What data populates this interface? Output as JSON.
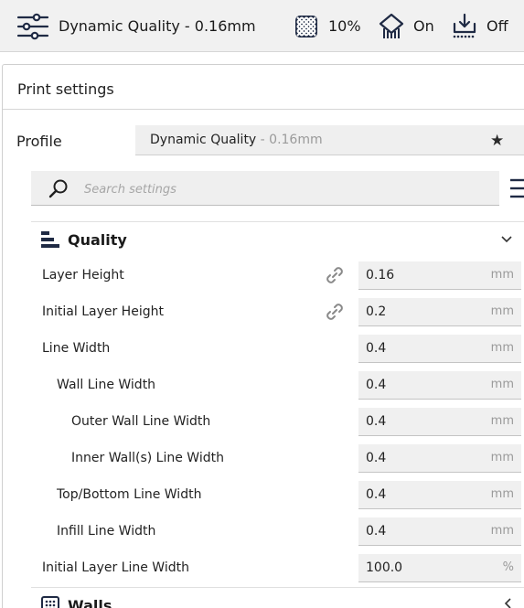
{
  "header": {
    "profile_summary": "Dynamic Quality - 0.16mm",
    "infill_value": "10%",
    "support_value": "On",
    "adhesion_value": "Off",
    "icons": [
      "sliders-icon",
      "infill-icon",
      "support-icon",
      "adhesion-icon"
    ]
  },
  "panel": {
    "title": "Print settings"
  },
  "profile": {
    "label": "Profile",
    "name": "Dynamic Quality",
    "suffix": " - 0.16mm",
    "icon": "star-icon"
  },
  "search": {
    "placeholder": "Search settings",
    "icon": "search-icon",
    "menu_icon": "menu-icon"
  },
  "quality": {
    "title": "Quality",
    "icon": "quality-icon",
    "rows": [
      {
        "label": "Layer Height",
        "value": "0.16",
        "unit": "mm",
        "linked": true
      },
      {
        "label": "Initial Layer Height",
        "value": "0.2",
        "unit": "mm",
        "linked": true
      },
      {
        "label": "Line Width",
        "value": "0.4",
        "unit": "mm",
        "linked": false
      },
      {
        "label": "Wall Line Width",
        "value": "0.4",
        "unit": "mm",
        "linked": false
      },
      {
        "label": "Outer Wall Line Width",
        "value": "0.4",
        "unit": "mm",
        "linked": false
      },
      {
        "label": "Inner Wall(s) Line Width",
        "value": "0.4",
        "unit": "mm",
        "linked": false
      },
      {
        "label": "Top/Bottom Line Width",
        "value": "0.4",
        "unit": "mm",
        "linked": false
      },
      {
        "label": "Infill Line Width",
        "value": "0.4",
        "unit": "mm",
        "linked": false
      },
      {
        "label": "Initial Layer Line Width",
        "value": "100.0",
        "unit": "%",
        "linked": false
      }
    ]
  },
  "walls": {
    "title": "Walls",
    "icon": "walls-icon"
  },
  "colors": {
    "header_bg": "#f1f1f1",
    "field_bg": "#f0f0f0",
    "unit_text": "#9a9a9a",
    "icon_dark": "#1f2a44"
  }
}
